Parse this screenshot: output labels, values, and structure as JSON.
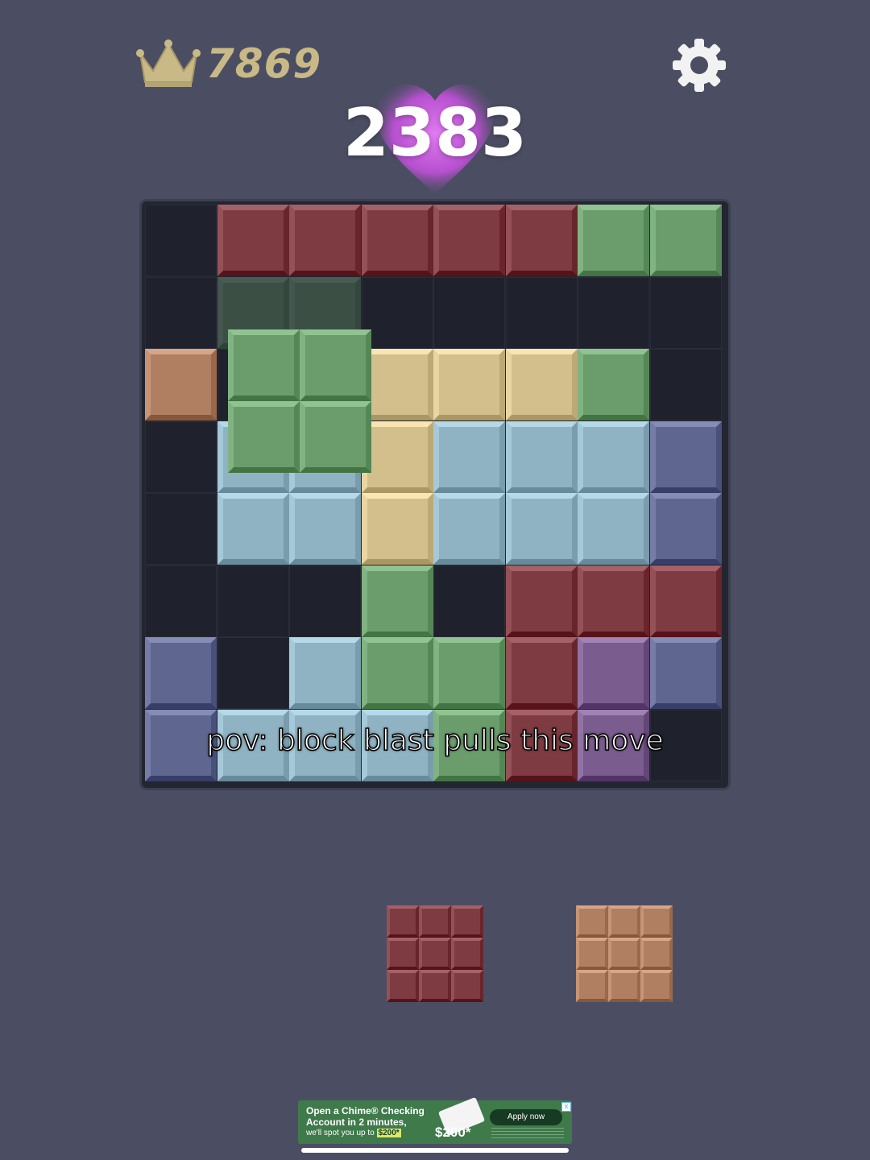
{
  "best_score": "7869",
  "current_score": "2383",
  "caption": "pov: block blast pulls this move",
  "colors": {
    "background": "#4b4e63",
    "empty": "#1f212c",
    "R": "#7e3b41",
    "G": "#6b9d6c",
    "T": "#d3bf8c",
    "C": "#8fb3c2",
    "B": "#5f668f",
    "P": "#7a5c8e",
    "O": "#b07f62",
    "heart": "#c45ad8",
    "crown": "#c8b986"
  },
  "board": {
    "rows": [
      ".RRRRRGG",
      ".hh.....",
      "O..TTTG.",
      ".CCTCCCB",
      ".CCTCCCB",
      "...G.RRR",
      "B.CGGRPB",
      "BCCCGRP."
    ]
  },
  "dragged_piece": {
    "color": "G",
    "shape": [
      "XX",
      "XX"
    ]
  },
  "tray": [
    {
      "color": "R",
      "shape": [
        "XXX",
        "XXX",
        "XXX"
      ]
    },
    {
      "color": "O",
      "shape": [
        "XXX",
        "XXX",
        "XXX"
      ]
    }
  ],
  "ad": {
    "line1": "Open a Chime® Checking",
    "line2": "Account in 2 minutes,",
    "line3": "we'll spot you up to",
    "amount": "$200*",
    "big_amount": "$200*",
    "button": "Apply now",
    "close": "x"
  },
  "icons": {
    "best": "crown-icon",
    "settings": "gear-icon",
    "score_bg": "heart-icon"
  }
}
